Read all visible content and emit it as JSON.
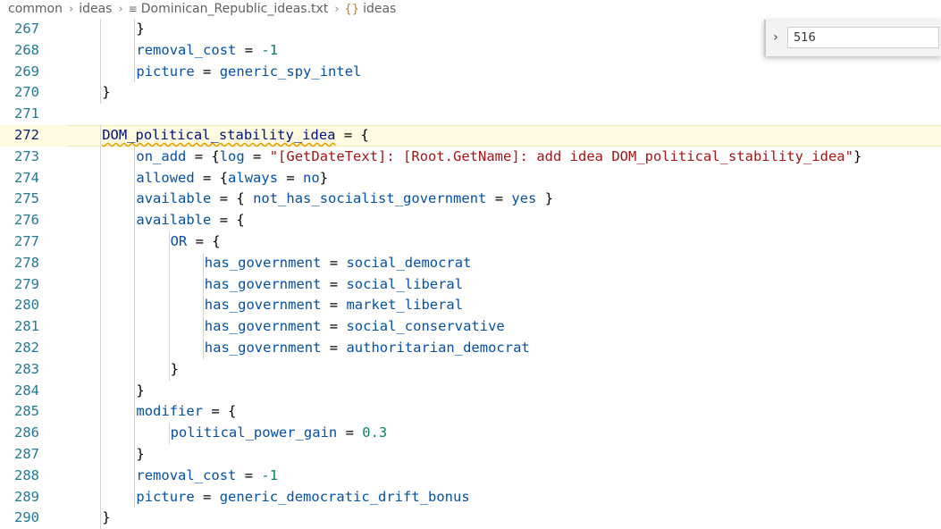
{
  "breadcrumb": {
    "items": [
      {
        "label": "common"
      },
      {
        "label": "ideas"
      },
      {
        "label": "Dominican_Republic_ideas.txt",
        "icon": "file-text-icon"
      },
      {
        "label": "ideas",
        "icon": "symbol-braces-icon"
      }
    ],
    "separator": "chevron-right-icon"
  },
  "find_widget": {
    "value": "516",
    "toggle_icon": "chevron-right-icon"
  },
  "colors": {
    "keyword": "#0451a5",
    "identifier": "#001080",
    "string": "#a31515",
    "number": "#098658",
    "line_number": "#237893",
    "current_line": "#fffbe1",
    "squiggle": "#e5a000"
  },
  "editor": {
    "current_line": 272,
    "lines": [
      {
        "n": "267",
        "t": "}"
      },
      {
        "n": "268",
        "t": "removal_cost = -1"
      },
      {
        "n": "269",
        "t": "picture = generic_spy_intel"
      },
      {
        "n": "270",
        "t": "}"
      },
      {
        "n": "271",
        "t": ""
      },
      {
        "n": "272",
        "t": "DOM_political_stability_idea = {"
      },
      {
        "n": "273",
        "t": "on_add = {log = \"[GetDateText]: [Root.GetName]: add idea DOM_political_stability_idea\"}"
      },
      {
        "n": "274",
        "t": "allowed = {always = no}"
      },
      {
        "n": "275",
        "t": "available = { not_has_socialist_government = yes }"
      },
      {
        "n": "276",
        "t": "available = {"
      },
      {
        "n": "277",
        "t": "OR = {"
      },
      {
        "n": "278",
        "t": "has_government = social_democrat"
      },
      {
        "n": "279",
        "t": "has_government = social_liberal"
      },
      {
        "n": "280",
        "t": "has_government = market_liberal"
      },
      {
        "n": "281",
        "t": "has_government = social_conservative"
      },
      {
        "n": "282",
        "t": "has_government = authoritarian_democrat"
      },
      {
        "n": "283",
        "t": "}"
      },
      {
        "n": "284",
        "t": "}"
      },
      {
        "n": "285",
        "t": "modifier = {"
      },
      {
        "n": "286",
        "t": "political_power_gain = 0.3"
      },
      {
        "n": "287",
        "t": "}"
      },
      {
        "n": "288",
        "t": "removal_cost = -1"
      },
      {
        "n": "289",
        "t": "picture = generic_democratic_drift_bonus"
      },
      {
        "n": "290",
        "t": "}"
      }
    ]
  }
}
